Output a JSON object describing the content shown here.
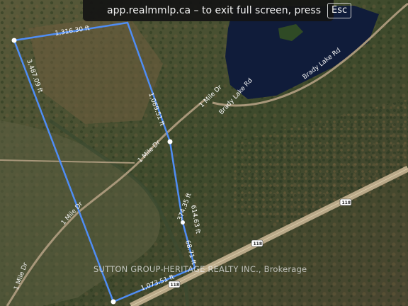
{
  "fullscreen_notice": {
    "message": "app.realmmlp.ca – to exit full screen, press",
    "key": "Esc"
  },
  "map": {
    "roads": {
      "brady_lake_rd_upper": "Brady Lake Rd",
      "brady_lake_rd_lower": "Brady Lake Rd",
      "mile_dr_north": "1 Mile Dr",
      "mile_dr_center": "1 Mile Dr",
      "mile_dr_west": "1 Mile Dr",
      "mile_dr_southwest": "1 Mile Dr",
      "mile_dr_south": "1 Mile Dr",
      "highway_shield_east": "118",
      "highway_shield_center": "118",
      "highway_shield_south": "118"
    },
    "dimensions": {
      "north_edge": "1,316.30 ft",
      "west_edge": "3,487.09 ft",
      "east_edge_upper": "1,069.51 ft",
      "east_edge_lower": "614.63 ft",
      "east_edge_notch": "374.35 ft",
      "east_edge_bottom": "68.71 ft",
      "south_edge": "1,073.51 ft"
    },
    "boundary_color": "#4f8df5"
  },
  "watermark": "SUTTON GROUP-HERITAGE REALTY INC., Brokerage"
}
